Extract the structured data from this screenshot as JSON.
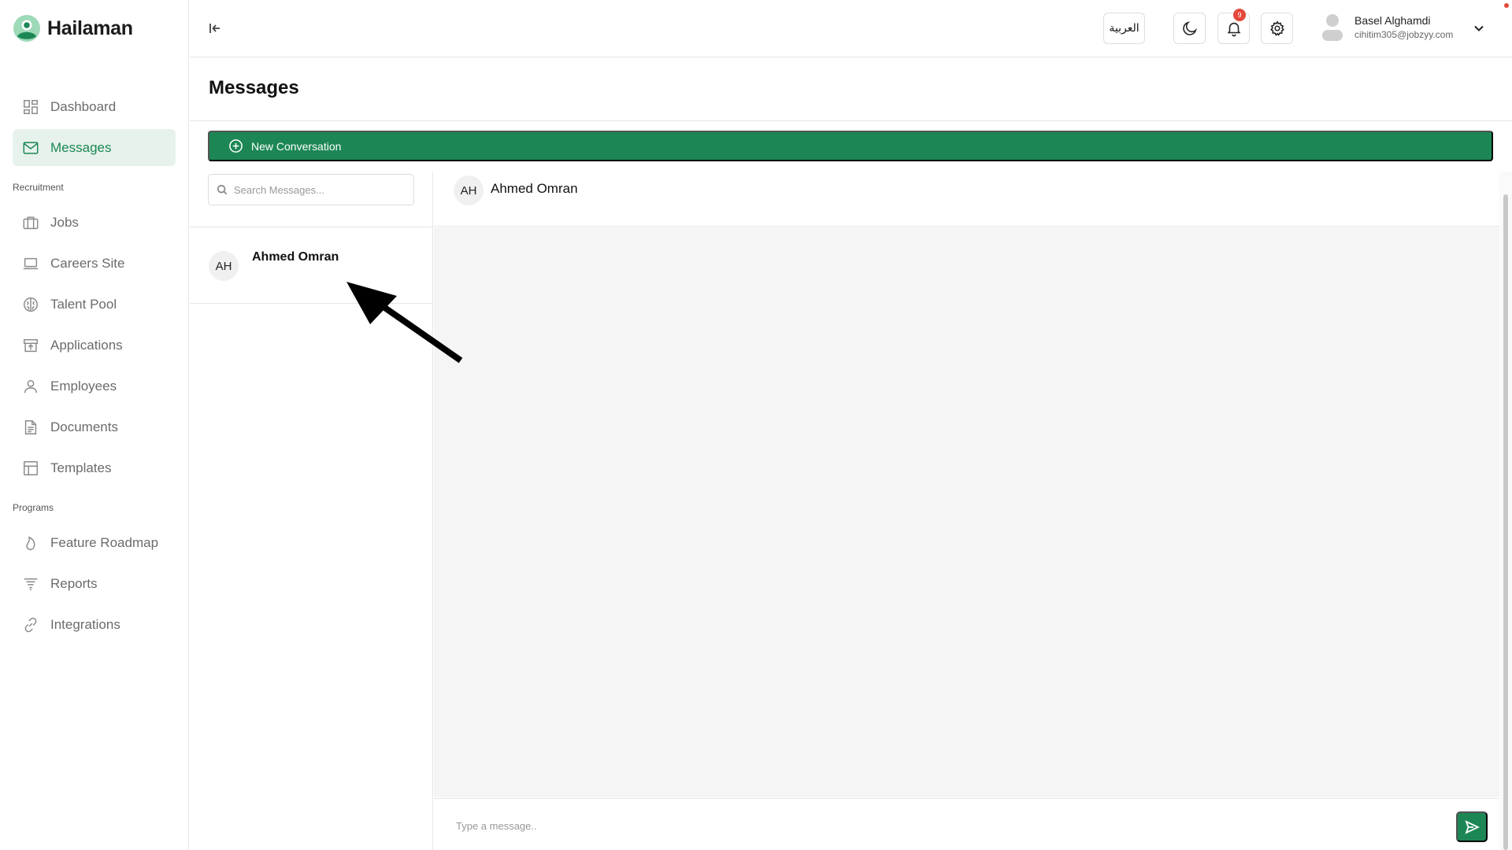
{
  "brand": {
    "name": "Hailaman"
  },
  "sidebar": {
    "main_items": [
      {
        "label": "Dashboard",
        "icon": "dashboard-icon"
      },
      {
        "label": "Messages",
        "icon": "mail-icon",
        "active": true
      }
    ],
    "section_recruitment": "Recruitment",
    "recruitment_items": [
      {
        "label": "Jobs",
        "icon": "briefcase-icon"
      },
      {
        "label": "Careers Site",
        "icon": "laptop-icon"
      },
      {
        "label": "Talent Pool",
        "icon": "brain-icon"
      },
      {
        "label": "Applications",
        "icon": "inbox-upload-icon"
      },
      {
        "label": "Employees",
        "icon": "user-icon"
      },
      {
        "label": "Documents",
        "icon": "document-icon"
      },
      {
        "label": "Templates",
        "icon": "layout-icon"
      }
    ],
    "section_programs": "Programs",
    "program_items": [
      {
        "label": "Feature Roadmap",
        "icon": "flame-icon"
      },
      {
        "label": "Reports",
        "icon": "filter-icon"
      },
      {
        "label": "Integrations",
        "icon": "link-icon"
      }
    ]
  },
  "topbar": {
    "language_label": "العربية",
    "notification_count": "9",
    "user": {
      "name": "Basel Alghamdi",
      "email": "cihitim305@jobzyy.com"
    }
  },
  "page": {
    "title": "Messages",
    "new_conversation_label": "New Conversation",
    "search_placeholder": "Search Messages...",
    "conversations": [
      {
        "initials": "AH",
        "name": "Ahmed Omran"
      }
    ],
    "active_chat": {
      "initials": "AH",
      "name": "Ahmed Omran"
    },
    "message_placeholder": "Type a message.."
  },
  "colors": {
    "primary": "#1c8755",
    "active_nav_bg": "#e7f2ec",
    "badge": "#e5483c",
    "chat_bg": "#f5f5f5"
  }
}
